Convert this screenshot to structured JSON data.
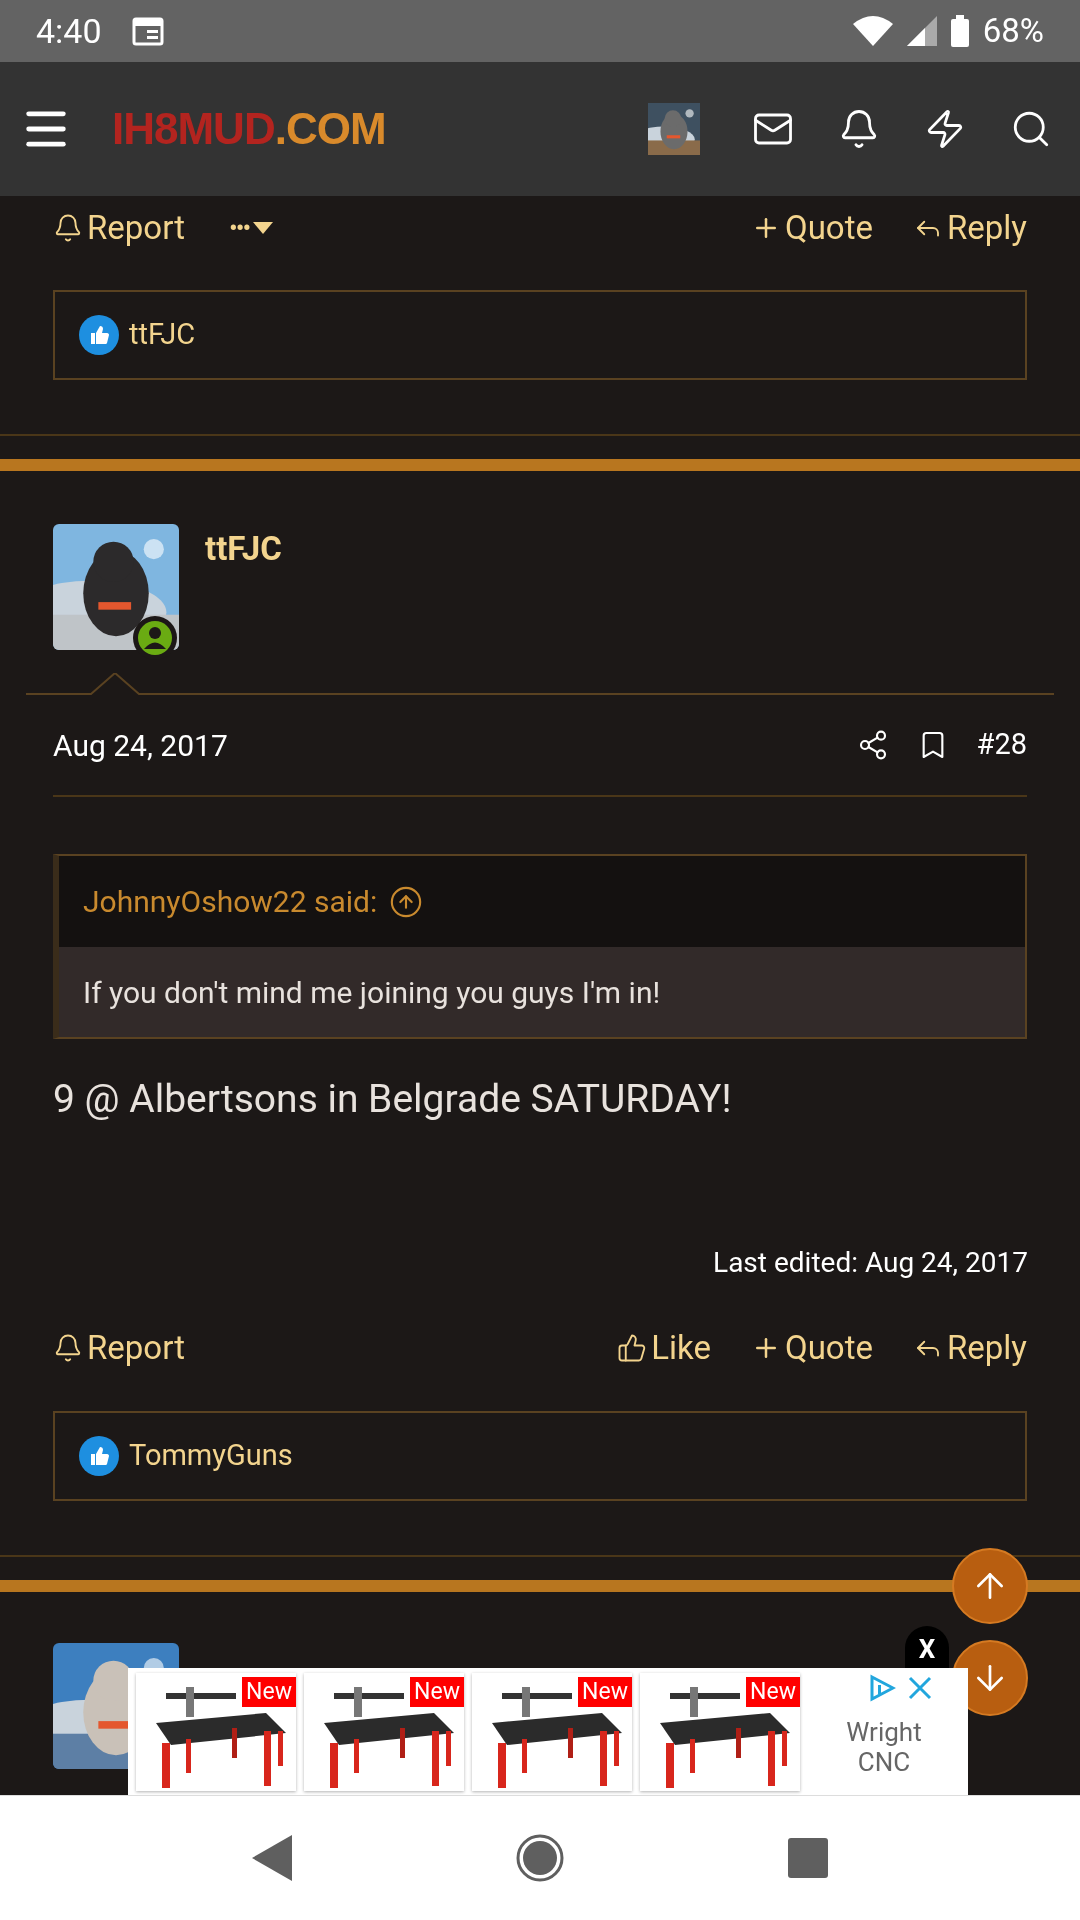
{
  "status_bar": {
    "time": "4:40",
    "battery": "68%"
  },
  "header": {
    "logo": [
      {
        "text": "IH8MUD",
        "color": "#b3241f"
      },
      {
        "text": ".COM",
        "color": "#d98a2b"
      }
    ]
  },
  "previous_post": {
    "actions": [
      {
        "kind": "report",
        "label": "Report"
      },
      {
        "kind": "more",
        "label": "•••"
      },
      {
        "kind": "quote",
        "label": "Quote"
      },
      {
        "kind": "reply",
        "label": "Reply"
      }
    ],
    "reactions": "ttFJC"
  },
  "post": {
    "author": "ttFJC",
    "online": true,
    "date": "Aug 24, 2017",
    "number": "#28",
    "quote": {
      "author": "JohnnyOshow22 said:",
      "text": "If you don't mind me joining you guys I'm in!"
    },
    "body": "9 @ Albertsons in Belgrade SATURDAY!",
    "last_edited": "Last edited: Aug 24, 2017",
    "actions": [
      {
        "kind": "report",
        "label": "Report"
      },
      {
        "kind": "like",
        "label": "Like"
      },
      {
        "kind": "quote",
        "label": "Quote"
      },
      {
        "kind": "reply",
        "label": "Reply"
      }
    ],
    "reactions": "TommyGuns"
  },
  "ad": {
    "close": "X",
    "items": [
      {
        "badge": "New"
      },
      {
        "badge": "New"
      },
      {
        "badge": "New"
      },
      {
        "badge": "New"
      }
    ],
    "advertiser": "Wright CNC"
  }
}
